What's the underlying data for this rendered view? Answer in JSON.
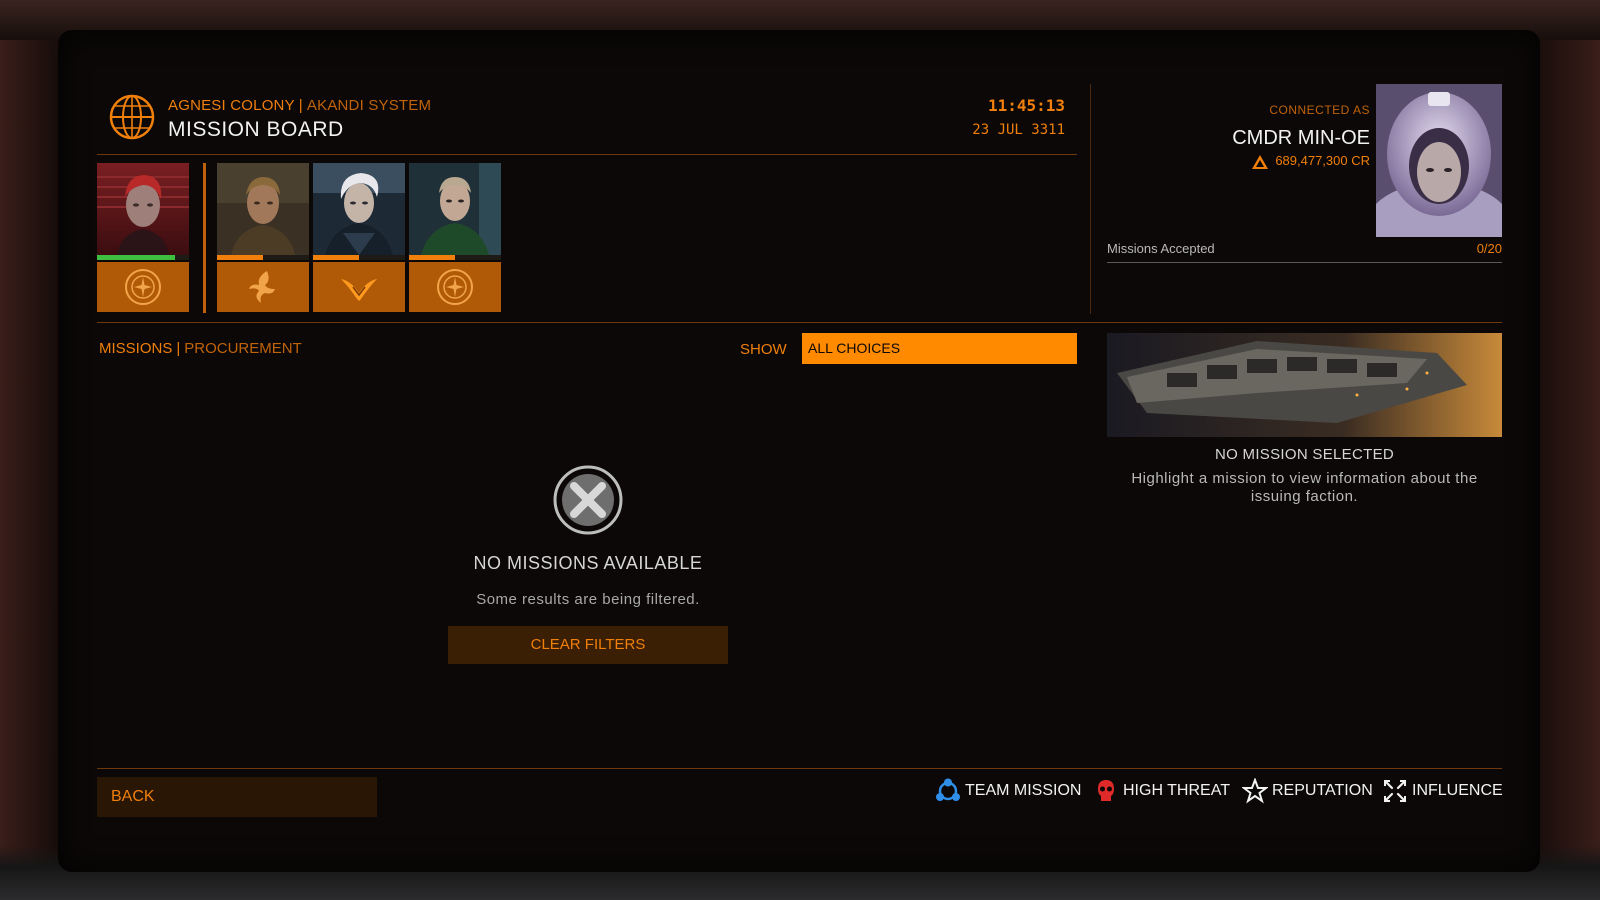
{
  "header": {
    "location": "AGNESI COLONY",
    "system": "AKANDI SYSTEM",
    "title": "MISSION BOARD",
    "time": "11:45:13",
    "date": "23 JUL 3311"
  },
  "factions": [
    {
      "name": "faction-1",
      "emblem": "federation-icon",
      "reputation": 0.85,
      "rep_color": "#3fbf3f"
    },
    {
      "name": "faction-2",
      "emblem": "phoenix-icon",
      "reputation": 0.5,
      "rep_color": "#f07f0c"
    },
    {
      "name": "faction-3",
      "emblem": "wings-icon",
      "reputation": 0.5,
      "rep_color": "#f07f0c"
    },
    {
      "name": "faction-4",
      "emblem": "federation-icon",
      "reputation": 0.5,
      "rep_color": "#f07f0c"
    }
  ],
  "commander": {
    "connected_label": "CONNECTED AS",
    "name": "CMDR MIN-OE",
    "credits": "689,477,300 CR",
    "missions_accepted_label": "Missions Accepted",
    "missions_accepted_value": "0/20"
  },
  "tabs": {
    "missions": "MISSIONS",
    "procurement": "PROCUREMENT"
  },
  "filter": {
    "show_label": "SHOW",
    "selected": "ALL CHOICES"
  },
  "empty_state": {
    "title": "NO MISSIONS AVAILABLE",
    "subtitle": "Some results are being filtered.",
    "clear_button": "CLEAR FILTERS"
  },
  "detail_panel": {
    "title": "NO MISSION SELECTED",
    "text_line1": "Highlight a mission to view information about the",
    "text_line2": "issuing faction."
  },
  "footer": {
    "back": "BACK",
    "legend": {
      "team": "TEAM MISSION",
      "threat": "HIGH THREAT",
      "reputation": "REPUTATION",
      "influence": "INFLUENCE"
    }
  },
  "colors": {
    "accent": "#f07f0c",
    "accent_dim": "#c1630b",
    "select_bg": "#ff8a00",
    "team_icon": "#2f8fe8",
    "threat_icon": "#e02a2a"
  }
}
